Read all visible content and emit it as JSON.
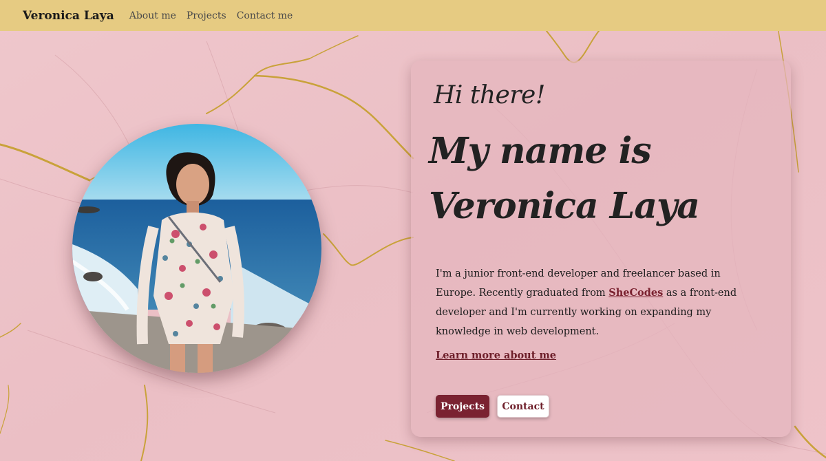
{
  "colors": {
    "navbar_bg": "#e6cb82",
    "page_bg": "#ecc1c7",
    "accent": "#7a2231",
    "gold_vein": "#c9a23a"
  },
  "navbar": {
    "brand": "Veronica Laya",
    "links": [
      "About me",
      "Projects",
      "Contact me"
    ]
  },
  "hero": {
    "greeting": "Hi there!",
    "headline": "My name is Veronica Laya",
    "bio_part1": "I'm a junior front-end developer and freelancer based in Europe. Recently graduated from ",
    "bio_link": "SheCodes",
    "bio_part2": " as a front-end developer and I'm currently working on expanding my knowledge in web development.",
    "learn_more": "Learn more about me",
    "buttons": {
      "projects": "Projects",
      "contact": "Contact"
    }
  },
  "photo": {
    "icon": "profile-photo"
  }
}
